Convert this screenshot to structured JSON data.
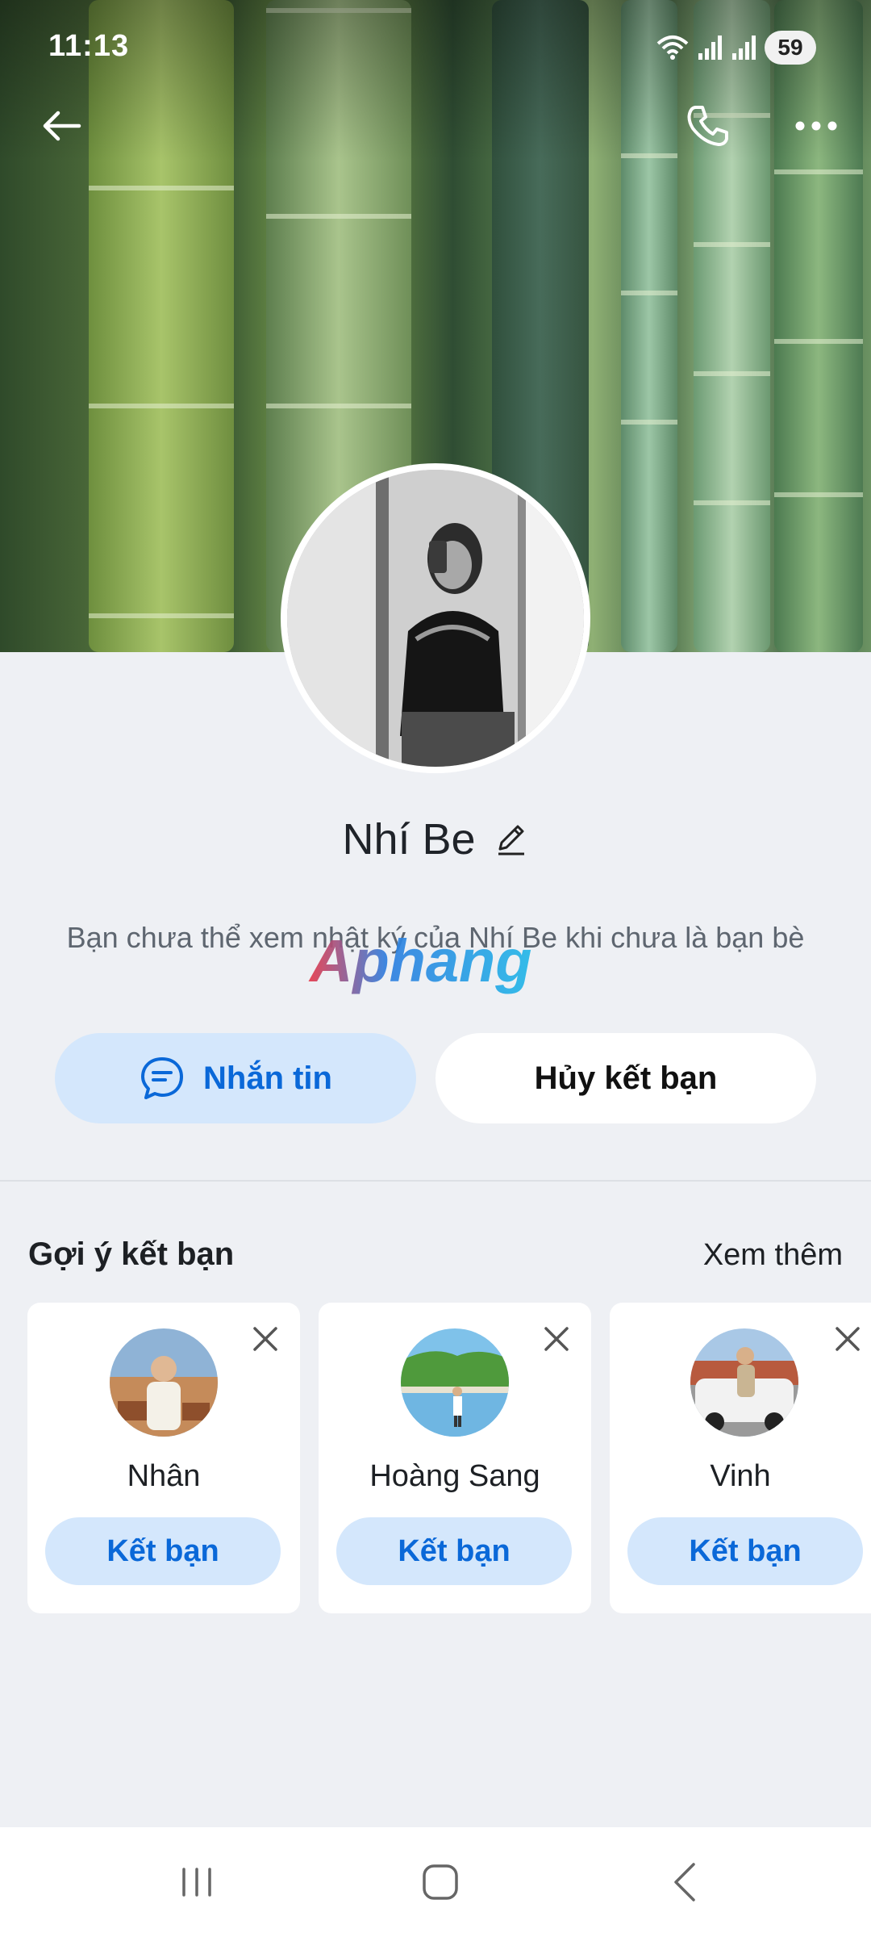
{
  "status_bar": {
    "time": "11:13",
    "battery": "59"
  },
  "profile": {
    "name": "Nhí Be",
    "notice": "Bạn chưa thể xem nhật ký của Nhí Be khi chưa là bạn bè"
  },
  "watermark": "Aphang",
  "actions": {
    "message_label": "Nhắn tin",
    "unfriend_label": "Hủy kết bạn"
  },
  "suggestions": {
    "title": "Gợi ý kết bạn",
    "more": "Xem thêm",
    "items": [
      {
        "name": "Nhân",
        "action": "Kết bạn"
      },
      {
        "name": "Hoàng Sang",
        "action": "Kết bạn"
      },
      {
        "name": "Vinh",
        "action": "Kết bạn"
      }
    ]
  },
  "colors": {
    "accent": "#0a68d8",
    "accent_soft": "#d4e7fc",
    "background": "#eef0f4"
  }
}
